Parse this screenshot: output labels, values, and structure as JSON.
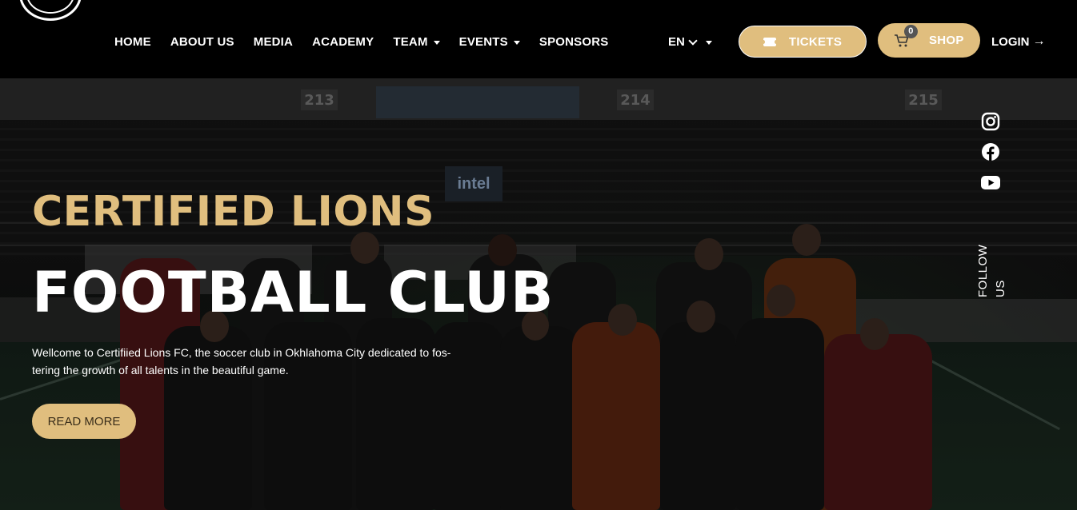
{
  "nav": {
    "items": [
      {
        "label": "HOME",
        "has_dropdown": false
      },
      {
        "label": "ABOUT US",
        "has_dropdown": false
      },
      {
        "label": "MEDIA",
        "has_dropdown": false
      },
      {
        "label": "ACADEMY",
        "has_dropdown": false
      },
      {
        "label": "TEAM",
        "has_dropdown": true
      },
      {
        "label": "EVENTS",
        "has_dropdown": true
      },
      {
        "label": "SPONSORS",
        "has_dropdown": false
      }
    ],
    "language": "EN",
    "tickets_label": "TICKETS",
    "shop_label": "SHOP",
    "cart_count": "0",
    "login_label": "LOGIN"
  },
  "hero": {
    "subtitle": "CERTIFIED LIONS",
    "title": "FOOTBALL CLUB",
    "description": "Wellcome to Certifiied Lions FC, the soccer club in Okhlahoma City dedicated to fos-tering the growth of all talents in the beautiful game.",
    "cta_label": "READ MORE"
  },
  "stadium": {
    "sections": [
      "213",
      "214",
      "215"
    ],
    "sponsor_sign": "intel"
  },
  "social": {
    "icons": [
      "instagram-icon",
      "facebook-icon",
      "youtube-icon"
    ],
    "follow_label": "FOLLOW US"
  },
  "colors": {
    "accent_gold": "#e0be7e",
    "header_bg": "#000000"
  }
}
